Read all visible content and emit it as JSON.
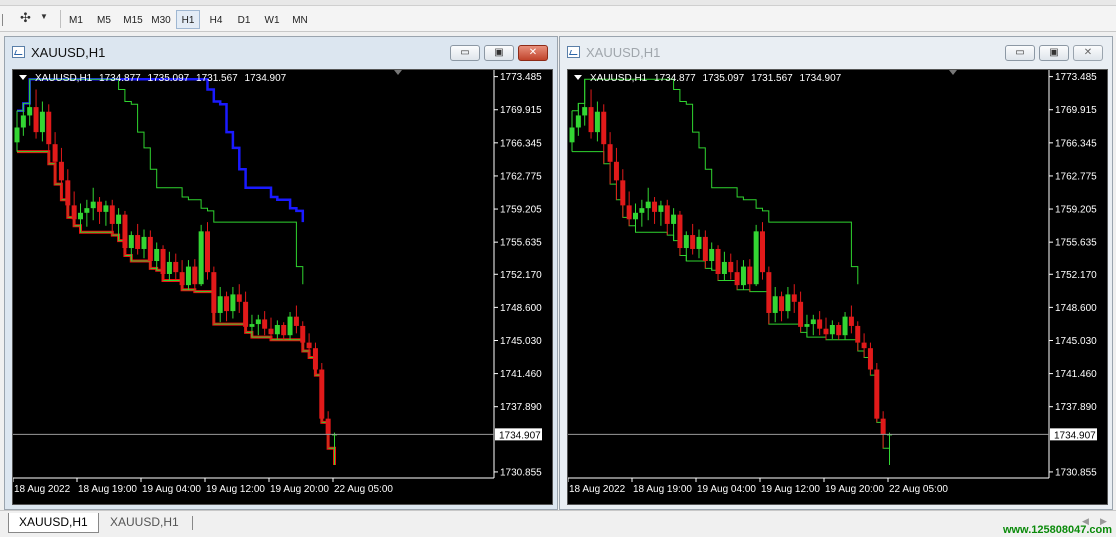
{
  "toolbar": {
    "tool_icon": "crosshair-icon",
    "timeframes": [
      {
        "label": "M1",
        "active": false
      },
      {
        "label": "M5",
        "active": false
      },
      {
        "label": "M15",
        "active": false
      },
      {
        "label": "M30",
        "active": false
      },
      {
        "label": "H1",
        "active": true
      },
      {
        "label": "H4",
        "active": false
      },
      {
        "label": "D1",
        "active": false
      },
      {
        "label": "W1",
        "active": false
      },
      {
        "label": "MN",
        "active": false
      }
    ]
  },
  "windows": [
    {
      "title": "XAUUSD,H1",
      "active": true,
      "info": {
        "symbol": "XAUUSD,H1",
        "open": "1734.877",
        "high": "1735.097",
        "low": "1731.567",
        "close": "1734.907"
      },
      "indicators": [
        "red-lower-channel",
        "blue-upper-line",
        "green-channel"
      ]
    },
    {
      "title": "XAUUSD,H1",
      "active": false,
      "info": {
        "symbol": "XAUUSD,H1",
        "open": "1734.877",
        "high": "1735.097",
        "low": "1731.567",
        "close": "1734.907"
      },
      "indicators": [
        "green-channel"
      ]
    }
  ],
  "chart_data": {
    "type": "candlestick",
    "y_ticks": [
      "1773.485",
      "1769.915",
      "1766.345",
      "1762.775",
      "1759.205",
      "1755.635",
      "1752.170",
      "1748.600",
      "1745.030",
      "1741.460",
      "1737.890",
      "1730.855"
    ],
    "ylim": [
      1730.2,
      1774.2
    ],
    "current_price": "1734.907",
    "x_labels": [
      "18 Aug 2022",
      "18 Aug 19:00",
      "19 Aug 04:00",
      "19 Aug 12:00",
      "19 Aug 20:00",
      "22 Aug 05:00"
    ],
    "candles": [
      {
        "o": 1766.4,
        "h": 1769.8,
        "l": 1765.4,
        "c": 1768.0
      },
      {
        "o": 1768.0,
        "h": 1770.6,
        "l": 1767.1,
        "c": 1769.3
      },
      {
        "o": 1769.3,
        "h": 1773.2,
        "l": 1768.2,
        "c": 1770.2
      },
      {
        "o": 1770.2,
        "h": 1772.1,
        "l": 1766.8,
        "c": 1767.5
      },
      {
        "o": 1767.5,
        "h": 1770.8,
        "l": 1766.5,
        "c": 1769.7
      },
      {
        "o": 1769.7,
        "h": 1770.5,
        "l": 1764.1,
        "c": 1766.2
      },
      {
        "o": 1766.2,
        "h": 1767.5,
        "l": 1761.9,
        "c": 1764.3
      },
      {
        "o": 1764.3,
        "h": 1765.8,
        "l": 1760.2,
        "c": 1762.3
      },
      {
        "o": 1762.3,
        "h": 1763.5,
        "l": 1758.3,
        "c": 1759.6
      },
      {
        "o": 1759.6,
        "h": 1761.1,
        "l": 1757.4,
        "c": 1758.1
      },
      {
        "o": 1758.1,
        "h": 1759.8,
        "l": 1756.7,
        "c": 1758.8
      },
      {
        "o": 1758.8,
        "h": 1760.2,
        "l": 1757.3,
        "c": 1759.3
      },
      {
        "o": 1759.3,
        "h": 1761.5,
        "l": 1758.0,
        "c": 1760.0
      },
      {
        "o": 1760.0,
        "h": 1760.5,
        "l": 1757.6,
        "c": 1758.9
      },
      {
        "o": 1758.9,
        "h": 1760.1,
        "l": 1757.4,
        "c": 1759.6
      },
      {
        "o": 1759.6,
        "h": 1760.2,
        "l": 1756.4,
        "c": 1757.6
      },
      {
        "o": 1757.6,
        "h": 1759.3,
        "l": 1755.8,
        "c": 1758.6
      },
      {
        "o": 1758.6,
        "h": 1759.0,
        "l": 1754.2,
        "c": 1755.0
      },
      {
        "o": 1755.0,
        "h": 1756.8,
        "l": 1753.6,
        "c": 1756.4
      },
      {
        "o": 1756.4,
        "h": 1757.6,
        "l": 1754.3,
        "c": 1754.9
      },
      {
        "o": 1754.9,
        "h": 1757.0,
        "l": 1753.9,
        "c": 1756.2
      },
      {
        "o": 1756.2,
        "h": 1756.9,
        "l": 1752.8,
        "c": 1753.6
      },
      {
        "o": 1753.6,
        "h": 1755.6,
        "l": 1752.6,
        "c": 1754.9
      },
      {
        "o": 1754.9,
        "h": 1755.3,
        "l": 1751.5,
        "c": 1752.2
      },
      {
        "o": 1752.2,
        "h": 1754.6,
        "l": 1751.5,
        "c": 1753.5
      },
      {
        "o": 1753.5,
        "h": 1754.4,
        "l": 1751.6,
        "c": 1752.4
      },
      {
        "o": 1752.4,
        "h": 1753.7,
        "l": 1750.5,
        "c": 1751.0
      },
      {
        "o": 1751.0,
        "h": 1753.7,
        "l": 1750.5,
        "c": 1753.0
      },
      {
        "o": 1753.0,
        "h": 1753.8,
        "l": 1750.3,
        "c": 1751.1
      },
      {
        "o": 1751.1,
        "h": 1757.5,
        "l": 1750.9,
        "c": 1756.8
      },
      {
        "o": 1756.8,
        "h": 1757.8,
        "l": 1751.6,
        "c": 1752.4
      },
      {
        "o": 1752.4,
        "h": 1753.0,
        "l": 1746.8,
        "c": 1748.0
      },
      {
        "o": 1748.0,
        "h": 1750.8,
        "l": 1747.0,
        "c": 1749.8
      },
      {
        "o": 1749.8,
        "h": 1750.3,
        "l": 1747.1,
        "c": 1748.2
      },
      {
        "o": 1748.2,
        "h": 1750.8,
        "l": 1747.4,
        "c": 1750.0
      },
      {
        "o": 1750.0,
        "h": 1751.1,
        "l": 1748.0,
        "c": 1749.2
      },
      {
        "o": 1749.2,
        "h": 1750.3,
        "l": 1745.9,
        "c": 1746.5
      },
      {
        "o": 1746.5,
        "h": 1747.8,
        "l": 1745.4,
        "c": 1746.8
      },
      {
        "o": 1746.8,
        "h": 1747.8,
        "l": 1745.6,
        "c": 1747.3
      },
      {
        "o": 1747.3,
        "h": 1748.2,
        "l": 1745.6,
        "c": 1746.3
      },
      {
        "o": 1746.3,
        "h": 1747.5,
        "l": 1745.1,
        "c": 1745.7
      },
      {
        "o": 1745.7,
        "h": 1747.2,
        "l": 1745.2,
        "c": 1746.7
      },
      {
        "o": 1746.7,
        "h": 1747.0,
        "l": 1745.1,
        "c": 1745.6
      },
      {
        "o": 1745.6,
        "h": 1748.1,
        "l": 1745.1,
        "c": 1747.6
      },
      {
        "o": 1747.6,
        "h": 1748.8,
        "l": 1745.8,
        "c": 1746.6
      },
      {
        "o": 1746.6,
        "h": 1747.1,
        "l": 1743.9,
        "c": 1744.8
      },
      {
        "o": 1744.8,
        "h": 1745.8,
        "l": 1743.2,
        "c": 1744.2
      },
      {
        "o": 1744.2,
        "h": 1744.8,
        "l": 1741.3,
        "c": 1741.9
      },
      {
        "o": 1741.9,
        "h": 1742.6,
        "l": 1736.2,
        "c": 1736.6
      },
      {
        "o": 1736.6,
        "h": 1737.4,
        "l": 1733.4,
        "c": 1734.9
      },
      {
        "o": 1734.9,
        "h": 1735.1,
        "l": 1731.6,
        "c": 1734.9
      }
    ]
  },
  "tabs": [
    {
      "label": "XAUUSD,H1",
      "active": true
    },
    {
      "label": "XAUUSD,H1",
      "active": false
    }
  ],
  "watermark": "www.125808047.com",
  "colors": {
    "bull": "#33d633",
    "bear": "#e11a1a",
    "blue_line": "#1a1aff",
    "red_line": "#ee1111",
    "green_line": "#2fd42f",
    "grid_text": "#ffffff"
  }
}
